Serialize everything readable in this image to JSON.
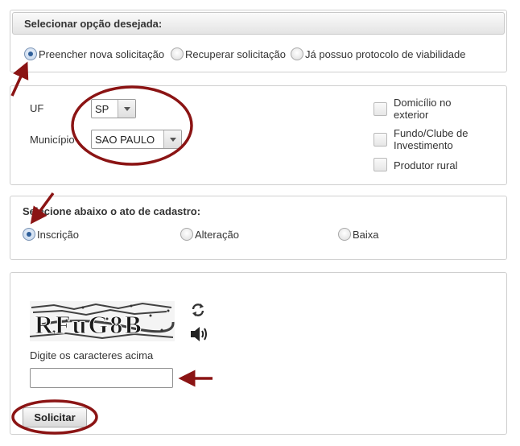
{
  "opcao": {
    "header": "Selecionar opção desejada:",
    "options": [
      "Preencher nova solicitação",
      "Recuperar solicitação",
      "Já possuo protocolo de viabilidade"
    ],
    "selected_index": 0
  },
  "local": {
    "uf_label": "UF",
    "uf_value": "SP",
    "municipio_label": "Município",
    "municipio_value": "SAO PAULO",
    "checkboxes": [
      "Domicílio no exterior",
      "Fundo/Clube de Investimento",
      "Produtor rural"
    ]
  },
  "ato": {
    "header": "Selecione abaixo o ato de cadastro:",
    "options": [
      "Inscrição",
      "Alteração",
      "Baixa"
    ],
    "selected_index": 0
  },
  "captcha": {
    "image_text": "RFuG8B",
    "instruction": "Digite os caracteres acima",
    "input_value": "",
    "refresh_icon": "refresh-icon",
    "audio_icon": "speaker-icon"
  },
  "submit_label": "Solicitar",
  "colors": {
    "annotation": "#8b1414",
    "radio_checked": "#2f5f9a"
  }
}
